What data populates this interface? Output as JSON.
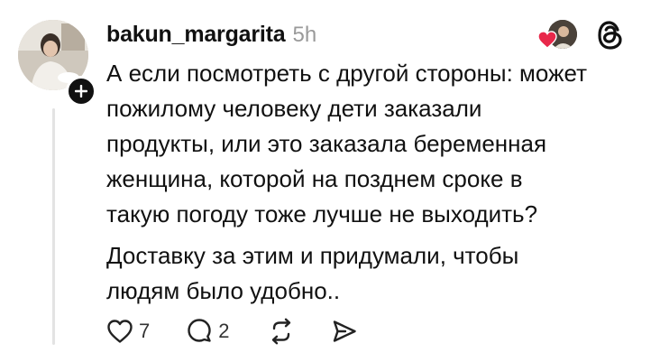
{
  "post": {
    "username": "bakun_margarita",
    "timestamp": "5h",
    "paragraphs": [
      "А если посмотреть с другой стороны: может\nпожилому человеку дети заказали\nпродукты, или это заказала беременная\nженщина,  которой на позднем сроке в\nтакую погоду тоже лучше не выходить?",
      "Доставку за этим и придумали, чтобы\nлюдям было удобно.."
    ]
  },
  "actions": {
    "like_count": "7",
    "reply_count": "2"
  },
  "icons": {
    "follow": "plus-icon",
    "threads": "threads-logo-icon",
    "like": "heart-icon",
    "reply": "speech-bubble-icon",
    "repost": "repost-icon",
    "share": "send-icon"
  },
  "colors": {
    "heart_red": "#e8284a",
    "muted_text": "#9a9a9a",
    "thread_line": "#e3e3e3"
  }
}
